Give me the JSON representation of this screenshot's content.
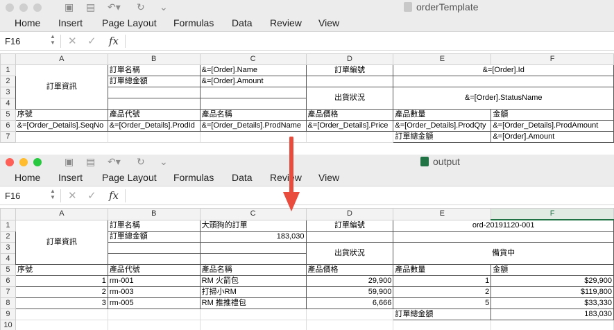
{
  "template": {
    "title": "orderTemplate",
    "tabs": [
      "Home",
      "Insert",
      "Page Layout",
      "Formulas",
      "Data",
      "Review",
      "View"
    ],
    "namebox": "F16",
    "fx": "fx",
    "columns": [
      "A",
      "B",
      "C",
      "D",
      "E",
      "F"
    ],
    "rows": [
      "1",
      "2",
      "3",
      "4",
      "5",
      "6",
      "7"
    ],
    "cells": {
      "r1": {
        "a": "訂單資訊",
        "b": "訂單名稱",
        "c": "&=[Order].Name",
        "d": "訂單編號",
        "ef": "&=[Order].Id"
      },
      "r2": {
        "b": "訂單總金額",
        "c": "&=[Order].Amount"
      },
      "r3": {
        "d": "出貨狀況",
        "ef": "&=[Order].StatusName"
      },
      "r5": {
        "a": "序號",
        "b": "產品代號",
        "c": "產品名稱",
        "d": "產品價格",
        "e": "產品數量",
        "f": "金額"
      },
      "r6": {
        "a": "&=[Order_Details].SeqNo",
        "b": "&=[Order_Details].ProdId",
        "c": "&=[Order_Details].ProdName",
        "d": "&=[Order_Details].Price",
        "e": "&=[Order_Details].ProdQty",
        "f": "&=[Order_Details].ProdAmount"
      },
      "r7": {
        "e": "訂單總金額",
        "f": "&=[Order].Amount"
      }
    }
  },
  "output": {
    "title": "output",
    "tabs": [
      "Home",
      "Insert",
      "Page Layout",
      "Formulas",
      "Data",
      "Review",
      "View"
    ],
    "namebox": "F16",
    "fx": "fx",
    "columns": [
      "A",
      "B",
      "C",
      "D",
      "E",
      "F"
    ],
    "rows": [
      "1",
      "2",
      "3",
      "4",
      "5",
      "6",
      "7",
      "8",
      "9",
      "10"
    ],
    "cells": {
      "r1": {
        "a": "訂單資訊",
        "b": "訂單名稱",
        "c": "大頭狗的訂單",
        "d": "訂單編號",
        "ef": "ord-20191120-001"
      },
      "r2": {
        "b": "訂單總金額",
        "c": "183,030"
      },
      "r3": {
        "d": "出貨狀況",
        "ef": "備貨中"
      },
      "r5": {
        "a": "序號",
        "b": "產品代號",
        "c": "產品名稱",
        "d": "產品價格",
        "e": "產品數量",
        "f": "金額"
      },
      "details": [
        {
          "a": "1",
          "b": "rm-001",
          "c": "RM 火箭包",
          "d": "29,900",
          "e": "1",
          "f": "$29,900"
        },
        {
          "a": "2",
          "b": "rm-003",
          "c": "打掃小RM",
          "d": "59,900",
          "e": "2",
          "f": "$119,800"
        },
        {
          "a": "3",
          "b": "rm-005",
          "c": "RM 推推禮包",
          "d": "6,666",
          "e": "5",
          "f": "$33,330"
        }
      ],
      "r9": {
        "e": "訂單總金額",
        "f": "183,030"
      }
    }
  },
  "colors": {
    "excel_green": "#217346",
    "arrow": "#e94b3c",
    "close": "#fe5f57",
    "minimize": "#febc2e",
    "zoom": "#28c840"
  }
}
